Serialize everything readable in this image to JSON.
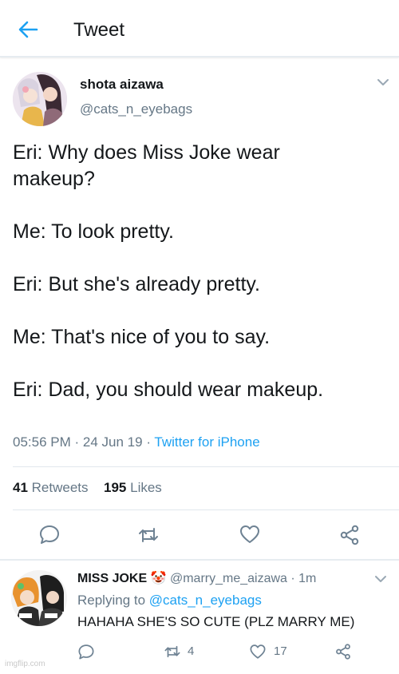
{
  "header": {
    "title": "Tweet",
    "back_icon": "arrow-left-icon"
  },
  "tweet": {
    "author_name": "shota aizawa",
    "author_handle": "@cats_n_eyebags",
    "text": "Eri: Why does Miss Joke wear\nmakeup?\n\nMe: To look pretty.\n\nEri: But she's already pretty.\n\nMe: That's nice of you to say.\n\nEri: Dad, you should wear makeup.",
    "time": "05:56 PM",
    "date": "24 Jun 19",
    "source": "Twitter for iPhone",
    "retweet_count": "41",
    "retweet_label": "Retweets",
    "like_count": "195",
    "like_label": "Likes"
  },
  "actions": [
    "reply-icon",
    "retweet-icon",
    "like-icon",
    "share-icon"
  ],
  "reply": {
    "name": "MISS JOKE",
    "emoji": "🤡",
    "handle": "@marry_me_aizawa",
    "time": "1m",
    "replying_label": "Replying to",
    "replying_to": "@cats_n_eyebags",
    "text": "HAHAHA SHE'S SO CUTE (PLZ MARRY ME)",
    "retweets": "4",
    "likes": "17"
  },
  "watermark": "imgflip.com",
  "colors": {
    "accent": "#1da1f2",
    "muted": "#657786",
    "icon": "#6e8293",
    "text": "#14171a",
    "divider": "#e1e8ed"
  }
}
